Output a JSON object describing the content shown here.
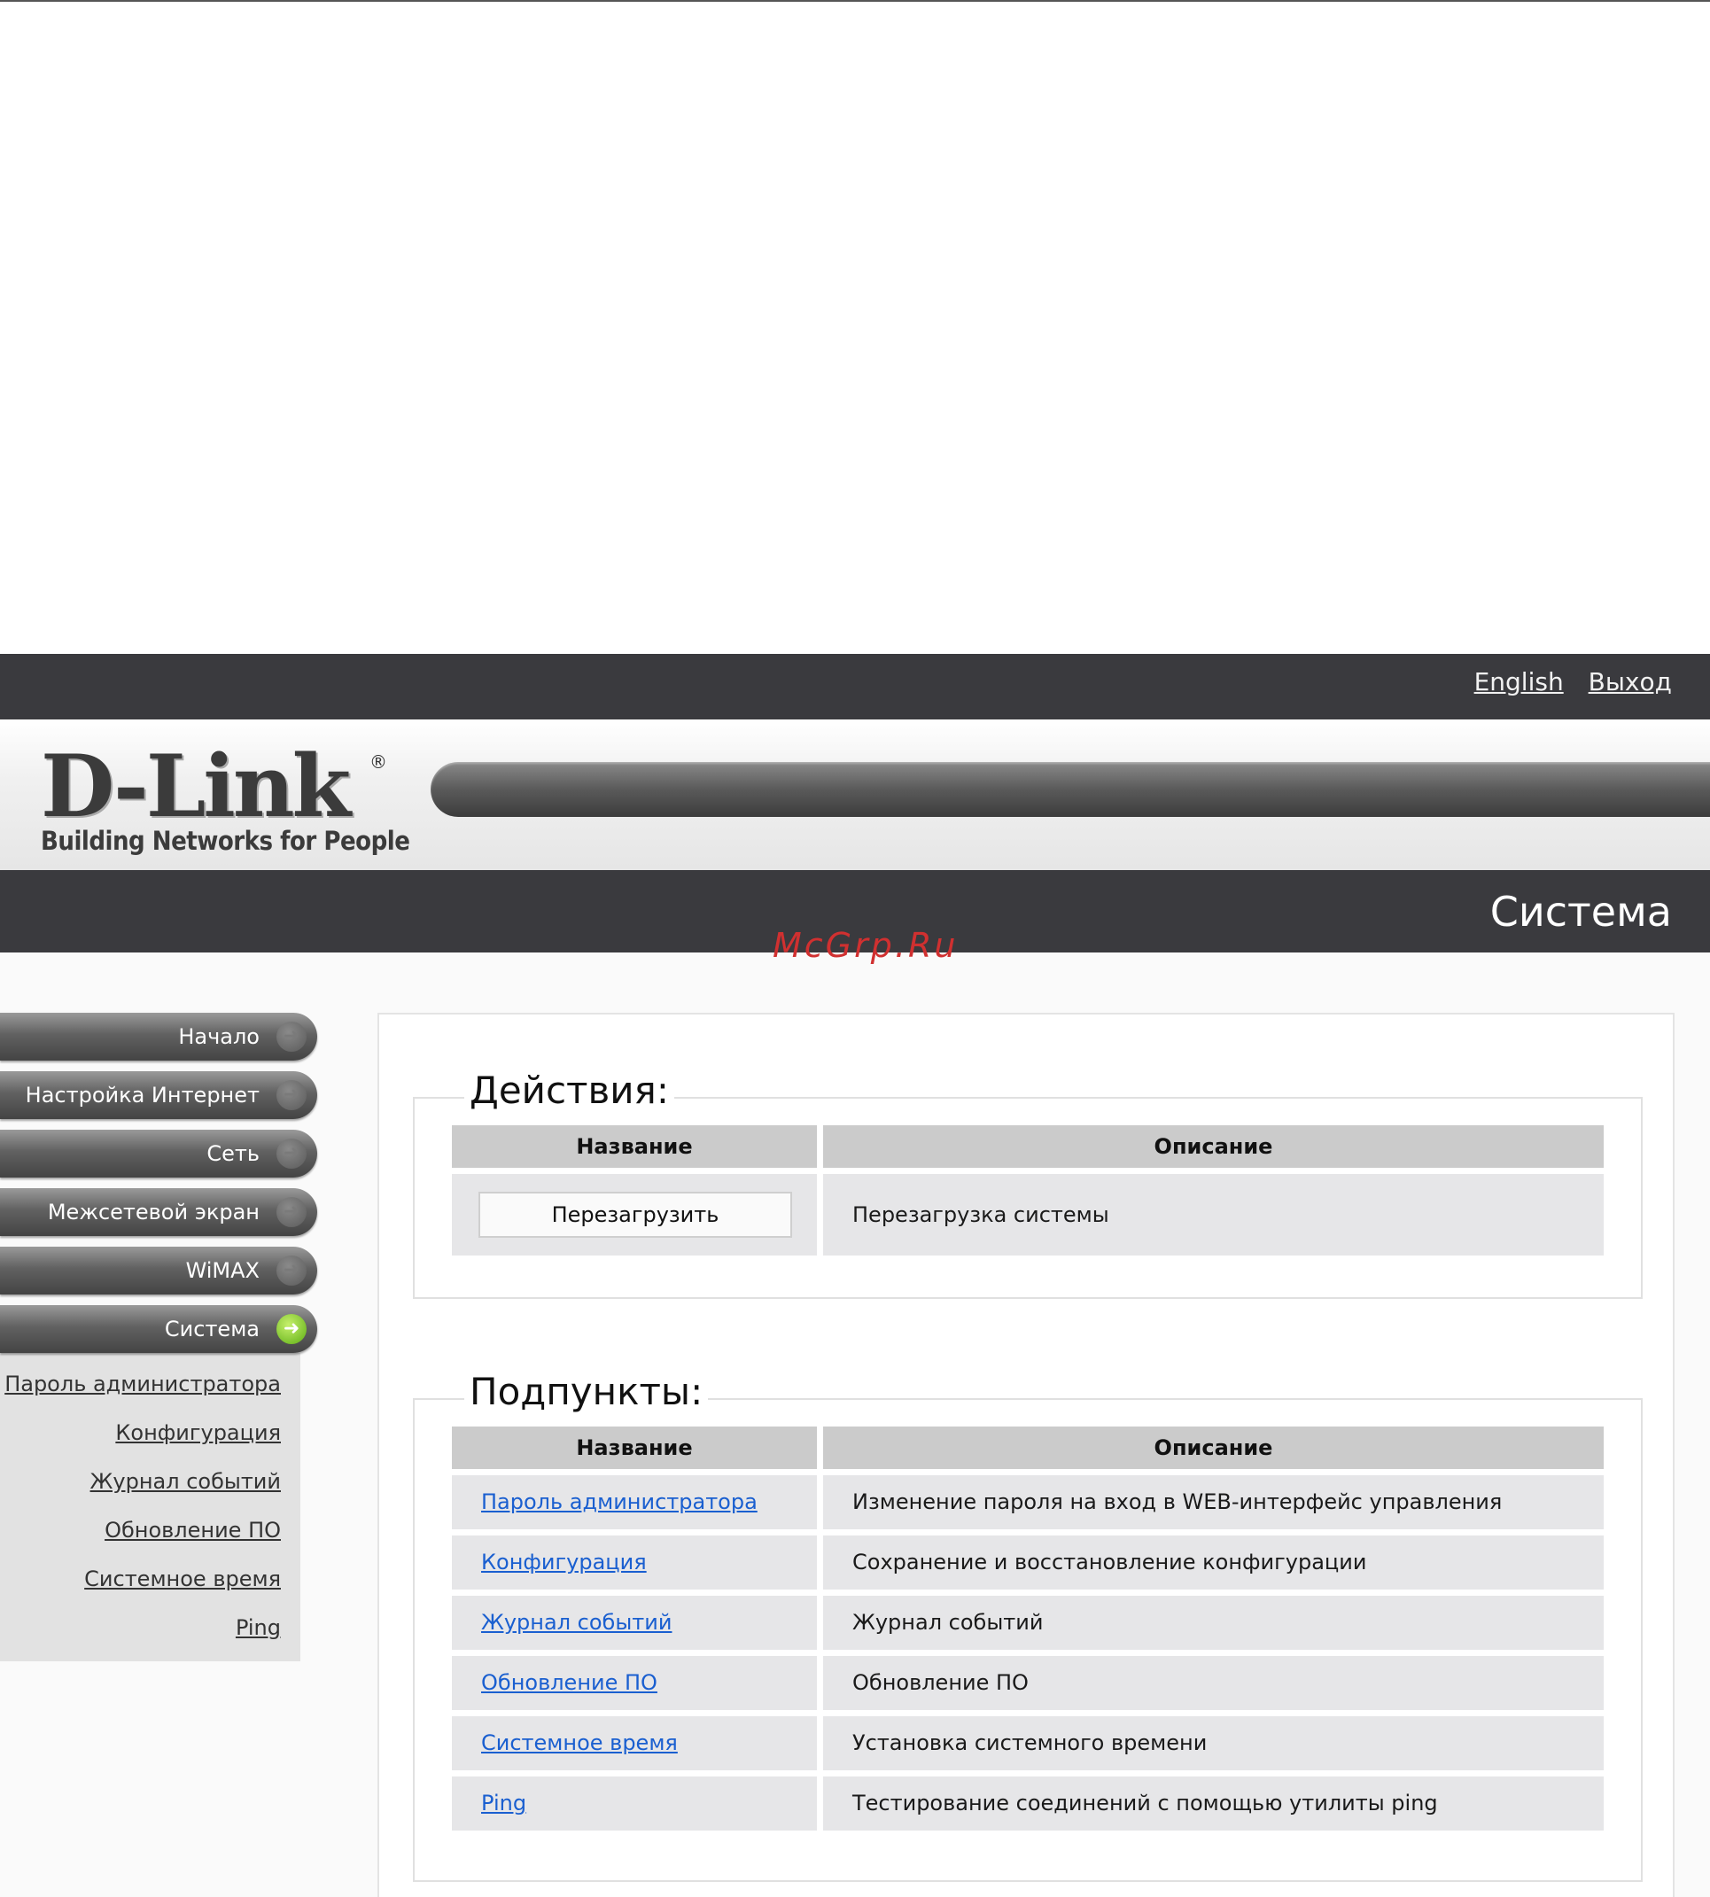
{
  "header": {
    "links": [
      "English",
      "Выход"
    ],
    "logo_main": "D-Link",
    "logo_reg": "®",
    "logo_tagline": "Building Networks for People",
    "page_title": "Система",
    "watermark": "McGrp.Ru"
  },
  "sidebar": {
    "items": [
      {
        "label": "Начало"
      },
      {
        "label": "Настройка Интернет"
      },
      {
        "label": "Сеть"
      },
      {
        "label": "Межсетевой экран"
      },
      {
        "label": "WiMAX"
      },
      {
        "label": "Система"
      }
    ],
    "active_index": 5,
    "submenu": [
      "Пароль администратора",
      "Конфигурация",
      "Журнал событий",
      "Обновление ПО",
      "Системное время",
      "Ping"
    ]
  },
  "actions": {
    "legend": "Действия:",
    "col_name": "Название",
    "col_desc": "Описание",
    "rows": [
      {
        "button": "Перезагрузить",
        "desc": "Перезагрузка системы"
      }
    ]
  },
  "subitems": {
    "legend": "Подпункты:",
    "col_name": "Название",
    "col_desc": "Описание",
    "rows": [
      {
        "name": "Пароль администратора",
        "desc": "Изменение пароля на вход в WEB-интерфейс управления"
      },
      {
        "name": "Конфигурация",
        "desc": "Сохранение и восстановление конфигурации"
      },
      {
        "name": "Журнал событий",
        "desc": "Журнал событий"
      },
      {
        "name": "Обновление ПО",
        "desc": "Обновление ПО"
      },
      {
        "name": "Системное время",
        "desc": "Установка системного времени"
      },
      {
        "name": "Ping",
        "desc": "Тестирование соединений с помощью утилиты ping"
      }
    ]
  },
  "colors": {
    "dark_bar": "#3a3a3e",
    "link": "#1a5fd0",
    "active_icon": "#5dae14"
  }
}
